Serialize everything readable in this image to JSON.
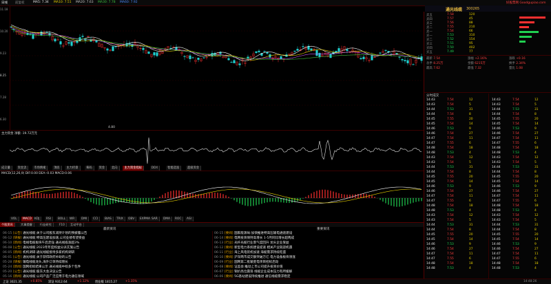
{
  "topbar": {
    "items": [
      "日线",
      "前复权",
      "MA5: 7.34",
      "MA10: 7.51",
      "MA20: 7.63",
      "MA30: 7.78",
      "MA60: 7.92"
    ],
    "right_label": "好股票网 Goodgupiao.com"
  },
  "stock": {
    "name": "通光线缆",
    "code": "300265"
  },
  "chart": {
    "y_ticks": [
      "11.18",
      "10.20",
      "9.23",
      "8.25",
      "7.28",
      "6.30"
    ],
    "low_label": "4.80",
    "volume_label": "主力资金 净额 -19.72万元"
  },
  "mid_tabs": [
    "成交量",
    "资金流",
    "市场情绪",
    "顶底",
    "主力控盘",
    "筹码",
    "资金",
    "北向",
    "主力资金指标",
    "DDX",
    "智能选股",
    "超级资金"
  ],
  "macd_label": "MACD(12,26,9) DIF:0.00 DEA:-0.03 MACD:0.06",
  "bottom_tabs": [
    "VOL",
    "MACD",
    "KDJ",
    "RSI",
    "BOLL",
    "WR",
    "DMI",
    "CCI",
    "BIAS",
    "TRIX",
    "OBV",
    "EXPMA",
    "SAR",
    "DMA",
    "ROC",
    "ASI"
  ],
  "right_panel": {
    "quote_rows": [
      {
        "label": "卖五",
        "price": "7.58",
        "vol": "120"
      },
      {
        "label": "卖四",
        "price": "7.57",
        "vol": "45"
      },
      {
        "label": "卖三",
        "price": "7.56",
        "vol": "88"
      },
      {
        "label": "卖二",
        "price": "7.55",
        "vol": "210"
      },
      {
        "label": "卖一",
        "price": "7.54",
        "vol": "66"
      },
      {
        "label": "买一",
        "price": "7.53",
        "vol": "310"
      },
      {
        "label": "买二",
        "price": "7.52",
        "vol": "154"
      },
      {
        "label": "买三",
        "price": "7.51",
        "vol": "95"
      },
      {
        "label": "买四",
        "price": "7.50",
        "vol": "402"
      },
      {
        "label": "买五",
        "price": "7.49",
        "vol": "77"
      }
    ],
    "stats": [
      {
        "k": "最新",
        "v": "7.54"
      },
      {
        "k": "涨幅",
        "v": "+2.16%"
      },
      {
        "k": "涨跌",
        "v": "+0.16"
      },
      {
        "k": "总手",
        "v": "8.25万"
      },
      {
        "k": "金额",
        "v": "6215万"
      },
      {
        "k": "换手",
        "v": "2.34%"
      },
      {
        "k": "最高",
        "v": "7.62"
      },
      {
        "k": "最低",
        "v": "7.32"
      },
      {
        "k": "量比",
        "v": "1.08"
      }
    ],
    "ticks_header": "分时成交",
    "ticks": [
      {
        "t": "14:43",
        "p": "7.54",
        "v": "12"
      },
      {
        "t": "14:43",
        "p": "7.54",
        "v": "5"
      },
      {
        "t": "14:44",
        "p": "7.53",
        "v": "31"
      },
      {
        "t": "14:44",
        "p": "7.54",
        "v": "8"
      },
      {
        "t": "14:45",
        "p": "7.55",
        "v": "20"
      },
      {
        "t": "14:45",
        "p": "7.54",
        "v": "14"
      },
      {
        "t": "14:46",
        "p": "7.53",
        "v": "9"
      },
      {
        "t": "14:46",
        "p": "7.54",
        "v": "27"
      },
      {
        "t": "14:47",
        "p": "7.54",
        "v": "11"
      },
      {
        "t": "14:47",
        "p": "7.55",
        "v": "6"
      },
      {
        "t": "14:48",
        "p": "7.54",
        "v": "18"
      },
      {
        "t": "14:48",
        "p": "7.53",
        "v": "4"
      }
    ]
  },
  "news": {
    "tabs": [
      "个股资讯",
      "大事提醒",
      "行业研究",
      "F10",
      "互动平台"
    ],
    "left_header": "最新资讯",
    "right_header": "重要资讯",
    "left_items": [
      {
        "date": "06-15",
        "cat": "[公告]",
        "title": "通光线缆:关于公司股东减持计划的预披露公告"
      },
      {
        "date": "06-12",
        "cat": "[研报]",
        "title": "通光线缆:特高压建设加速,公司业绩有望受益"
      },
      {
        "date": "06-10",
        "cat": "[新闻]",
        "title": "电线电缆板块午后走强 通光线缆涨超3%"
      },
      {
        "date": "06-08",
        "cat": "[公告]",
        "title": "通光线缆:2023年年度权益分派实施公告"
      },
      {
        "date": "06-05",
        "cat": "[新闻]",
        "title": "机构调研:通光线缆接待多家机构调研"
      },
      {
        "date": "06-01",
        "cat": "[公告]",
        "title": "通光线缆:关于获得政府补助的公告"
      },
      {
        "date": "05-28",
        "cat": "[研报]",
        "title": "输电线缆龙头,海外订单持续增长"
      },
      {
        "date": "05-24",
        "cat": "[新闻]",
        "title": "国网招标结果公示 通光线缆中标多个包件"
      },
      {
        "date": "05-20",
        "cat": "[公告]",
        "title": "通光线缆:股东大会决议公告"
      },
      {
        "date": "05-16",
        "cat": "[新闻]",
        "title": "通光线缆:公司产品广泛应用于电力通信领域"
      }
    ],
    "right_items": [
      {
        "date": "06-15",
        "cat": "[要闻]",
        "title": "国家能源局:加快推进特高压输电通道建设"
      },
      {
        "date": "06-14",
        "cat": "[要闻]",
        "title": "电网投资保持高增长 1-5月同比增长超两成"
      },
      {
        "date": "06-13",
        "cat": "[行业]",
        "title": "光纤光缆行业景气度回升 龙头企业受益"
      },
      {
        "date": "06-12",
        "cat": "[要闻]",
        "title": "新型电力系统建设提速 相关产业链迎机遇"
      },
      {
        "date": "06-11",
        "cat": "[行业]",
        "title": "海上风电装机加速 海缆需求持续旺盛"
      },
      {
        "date": "06-10",
        "cat": "[要闻]",
        "title": "沪深两市成交额突破万亿 电力设备板块领涨"
      },
      {
        "date": "06-09",
        "cat": "[行业]",
        "title": "国网第二批输变电项目招标启动"
      },
      {
        "date": "06-08",
        "cat": "[要闻]",
        "title": "证监会:推动上市公司提升投资价值"
      },
      {
        "date": "06-07",
        "cat": "[行业]",
        "title": "铜价高位震荡 线缆企业成本压力有所缓解"
      },
      {
        "date": "06-06",
        "cat": "[要闻]",
        "title": "5G基站建设持续推进 通信线缆需求稳定"
      }
    ]
  },
  "statusbar": {
    "items": [
      "上证 3021.35",
      "+0.85%",
      "深证 9312.64",
      "+1.12%",
      "创业板 1815.27",
      "+1.35%",
      "14:48:26"
    ]
  },
  "colors": {
    "up": "#ff3030",
    "down": "#20d050",
    "ma_white": "#ffffff",
    "ma_yellow": "#e8d000",
    "ma_purple": "#d060ff"
  }
}
